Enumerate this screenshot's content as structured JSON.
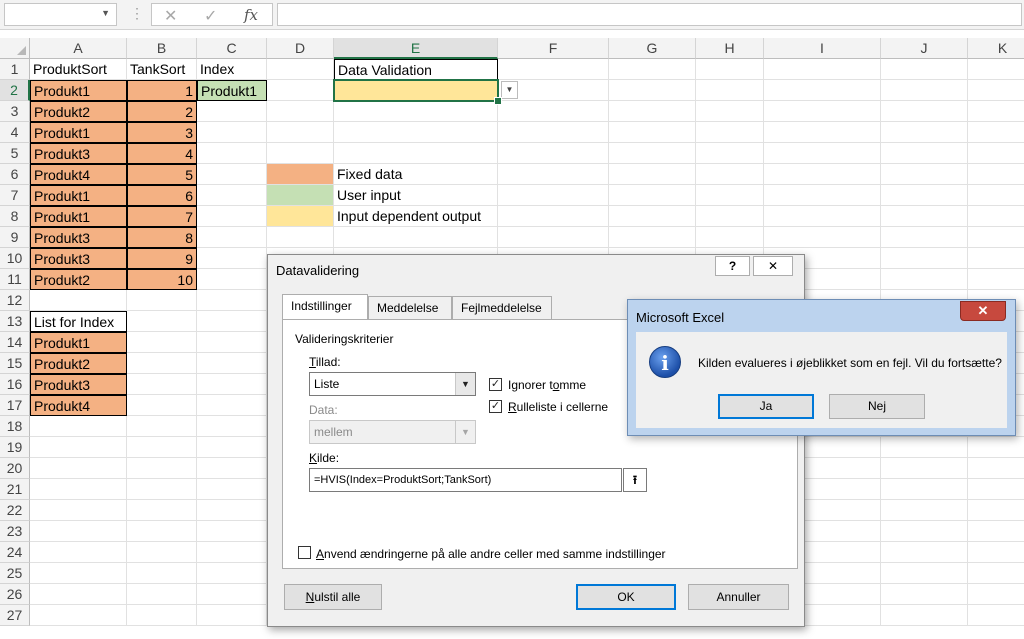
{
  "formula_bar": {
    "name_box": "",
    "separator": "⋮",
    "cancel_icon": "✕",
    "enter_icon": "✓",
    "fx_icon": "fx",
    "formula": ""
  },
  "columns": [
    "A",
    "B",
    "C",
    "D",
    "E",
    "F",
    "G",
    "H",
    "I",
    "J",
    "K"
  ],
  "rows": [
    "1",
    "2",
    "3",
    "4",
    "5",
    "6",
    "7",
    "8",
    "9",
    "10",
    "11",
    "12",
    "13",
    "14",
    "15",
    "16",
    "17",
    "18",
    "19",
    "20",
    "21",
    "22",
    "23",
    "24",
    "25",
    "26",
    "27"
  ],
  "cells": {
    "A1": "ProduktSort",
    "B1": "TankSort",
    "C1": "Index",
    "E1": "Data Validation",
    "A2": "Produkt1",
    "B2": "1",
    "C2": "Produkt1",
    "A3": "Produkt2",
    "B3": "2",
    "A4": "Produkt1",
    "B4": "3",
    "A5": "Produkt3",
    "B5": "4",
    "A6": "Produkt4",
    "B6": "5",
    "A7": "Produkt1",
    "B7": "6",
    "A8": "Produkt1",
    "B8": "7",
    "A9": "Produkt3",
    "B9": "8",
    "A10": "Produkt3",
    "B10": "9",
    "A11": "Produkt2",
    "B11": "10",
    "A13": "List for Index",
    "A14": "Produkt1",
    "A15": "Produkt2",
    "A16": "Produkt3",
    "A17": "Produkt4",
    "E6": "Fixed data",
    "E7": "User input",
    "E8": "Input dependent output"
  },
  "colors": {
    "fixed": "#f4b183",
    "user_input": "#c5e0b4",
    "output": "#ffe699",
    "excel_green": "#217346"
  },
  "dv_dialog": {
    "title": "Datavalidering",
    "help_icon": "?",
    "close_icon": "✕",
    "tabs": [
      "Indstillinger",
      "Meddelelse",
      "Fejlmeddelelse"
    ],
    "group_label": "Valideringskriterier",
    "allow_label_u": "T",
    "allow_label_rest": "illad:",
    "allow_value": "Liste",
    "data_label": "Data:",
    "data_value": "mellem",
    "ignore_blank_pre": "Ignorer t",
    "ignore_blank_u": "o",
    "ignore_blank_post": "mme",
    "in_cell_u": "R",
    "in_cell_rest": "ulleliste i cellerne",
    "source_label_u": "K",
    "source_label_rest": "ilde:",
    "source_value": "=HVIS(Index=ProduktSort;TankSort)",
    "apply_all_u": "A",
    "apply_all_rest": "nvend ændringerne på alle andre celler med samme indstillinger",
    "clear_all_u": "N",
    "clear_all_rest": "ulstil alle",
    "ok": "OK",
    "cancel": "Annuller"
  },
  "msgbox": {
    "title": "Microsoft Excel",
    "close_icon": "✕",
    "info_icon": "i",
    "message": "Kilden evalueres i øjeblikket som en fejl. Vil du fortsætte?",
    "yes": "Ja",
    "no": "Nej"
  }
}
